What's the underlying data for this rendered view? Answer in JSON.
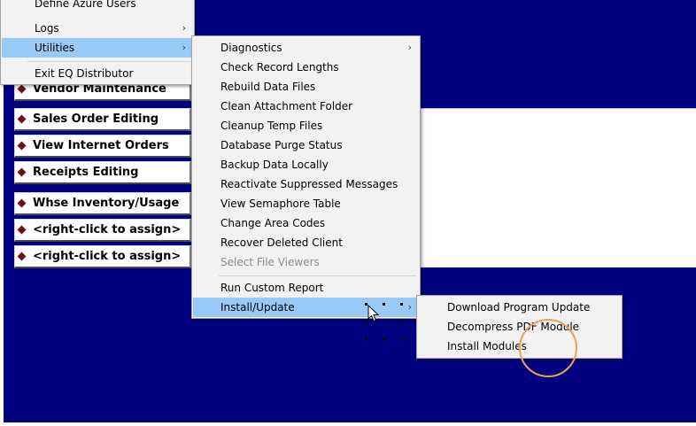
{
  "main_menu": {
    "items": [
      {
        "label": "Define Azure Users",
        "has_submenu": false
      },
      {
        "label": "Logs",
        "has_submenu": true
      },
      {
        "label": "Utilities",
        "has_submenu": true,
        "highlighted": true
      },
      {
        "label": "Exit EQ Distributor",
        "has_submenu": false
      }
    ]
  },
  "left_buttons": [
    {
      "label": "Vendor Maintenance"
    },
    {
      "label": "Sales Order Editing"
    },
    {
      "label": "View Internet Orders"
    },
    {
      "label": "Receipts Editing"
    },
    {
      "label": "Whse Inventory/Usage"
    },
    {
      "label": "<right-click to assign>"
    },
    {
      "label": "<right-click to assign>"
    }
  ],
  "utilities_menu": {
    "items": [
      {
        "label": "Diagnostics",
        "has_submenu": true
      },
      {
        "label": "Check Record Lengths"
      },
      {
        "label": "Rebuild Data Files"
      },
      {
        "label": "Clean Attachment Folder"
      },
      {
        "label": "Cleanup Temp Files"
      },
      {
        "label": "Database Purge Status"
      },
      {
        "label": "Backup Data Locally"
      },
      {
        "label": "Reactivate Suppressed Messages"
      },
      {
        "label": "View Semaphore Table"
      },
      {
        "label": "Change Area Codes"
      },
      {
        "label": "Recover Deleted Client"
      },
      {
        "label": "Select File Viewers",
        "disabled": true
      },
      {
        "label": "Run Custom Report"
      },
      {
        "label": "Install/Update",
        "has_submenu": true,
        "highlighted": true
      }
    ]
  },
  "install_update_menu": {
    "items": [
      {
        "label": "Download Program Update"
      },
      {
        "label": "Decompress PDF Module"
      },
      {
        "label": "Install Modules"
      }
    ]
  },
  "icons": {
    "submenu_arrow": "›",
    "button_bullet": "diamond-bullet-icon",
    "pointer": "mouse-pointer-icon"
  },
  "colors": {
    "desktop_background": "#000080",
    "menu_background": "#f2f2f2",
    "menu_highlight": "#99c9f7",
    "button_bullet": "#6b0f1a",
    "annotation_circle": "#f0a050"
  }
}
